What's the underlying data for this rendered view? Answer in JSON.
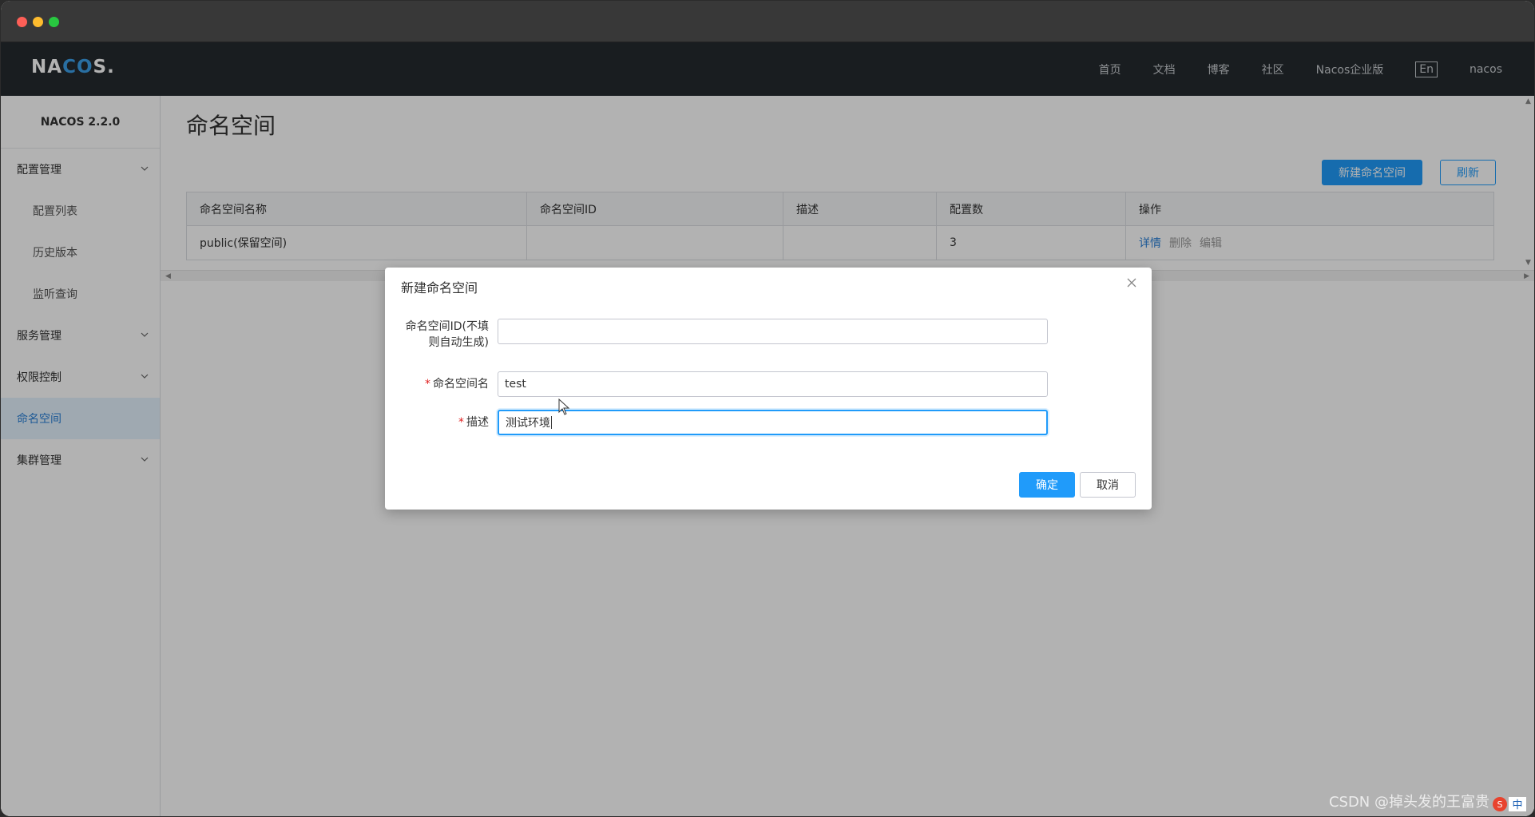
{
  "nav": {
    "logo": "NACOS.",
    "links": [
      "首页",
      "文档",
      "博客",
      "社区",
      "Nacos企业版"
    ],
    "lang": "En",
    "user": "nacos"
  },
  "sidebar": {
    "version": "NACOS 2.2.0",
    "items": [
      {
        "label": "配置管理",
        "type": "group"
      },
      {
        "label": "配置列表",
        "type": "sub"
      },
      {
        "label": "历史版本",
        "type": "sub"
      },
      {
        "label": "监听查询",
        "type": "sub"
      },
      {
        "label": "服务管理",
        "type": "group"
      },
      {
        "label": "权限控制",
        "type": "group"
      },
      {
        "label": "命名空间",
        "type": "active"
      },
      {
        "label": "集群管理",
        "type": "group"
      }
    ]
  },
  "main": {
    "title": "命名空间",
    "new_button": "新建命名空间",
    "refresh_button": "刷新",
    "table": {
      "headers": [
        "命名空间名称",
        "命名空间ID",
        "描述",
        "配置数",
        "操作"
      ],
      "rows": [
        {
          "name": "public(保留空间)",
          "id": "",
          "desc": "",
          "count": "3",
          "ops": [
            "详情",
            "删除",
            "编辑"
          ]
        }
      ]
    }
  },
  "dialog": {
    "title": "新建命名空间",
    "fields": {
      "id_label_line1": "命名空间ID(不填",
      "id_label_line2": "则自动生成)",
      "id_value": "",
      "name_label": "命名空间名",
      "name_value": "test",
      "desc_label": "描述",
      "desc_value": "测试环境"
    },
    "ok_button": "确定",
    "cancel_button": "取消"
  },
  "watermark": "CSDN @掉头发的王富贵",
  "ime": "中",
  "colors": {
    "primary": "#209bfa",
    "nav_bg": "#252a2f",
    "required": "#e02020"
  }
}
